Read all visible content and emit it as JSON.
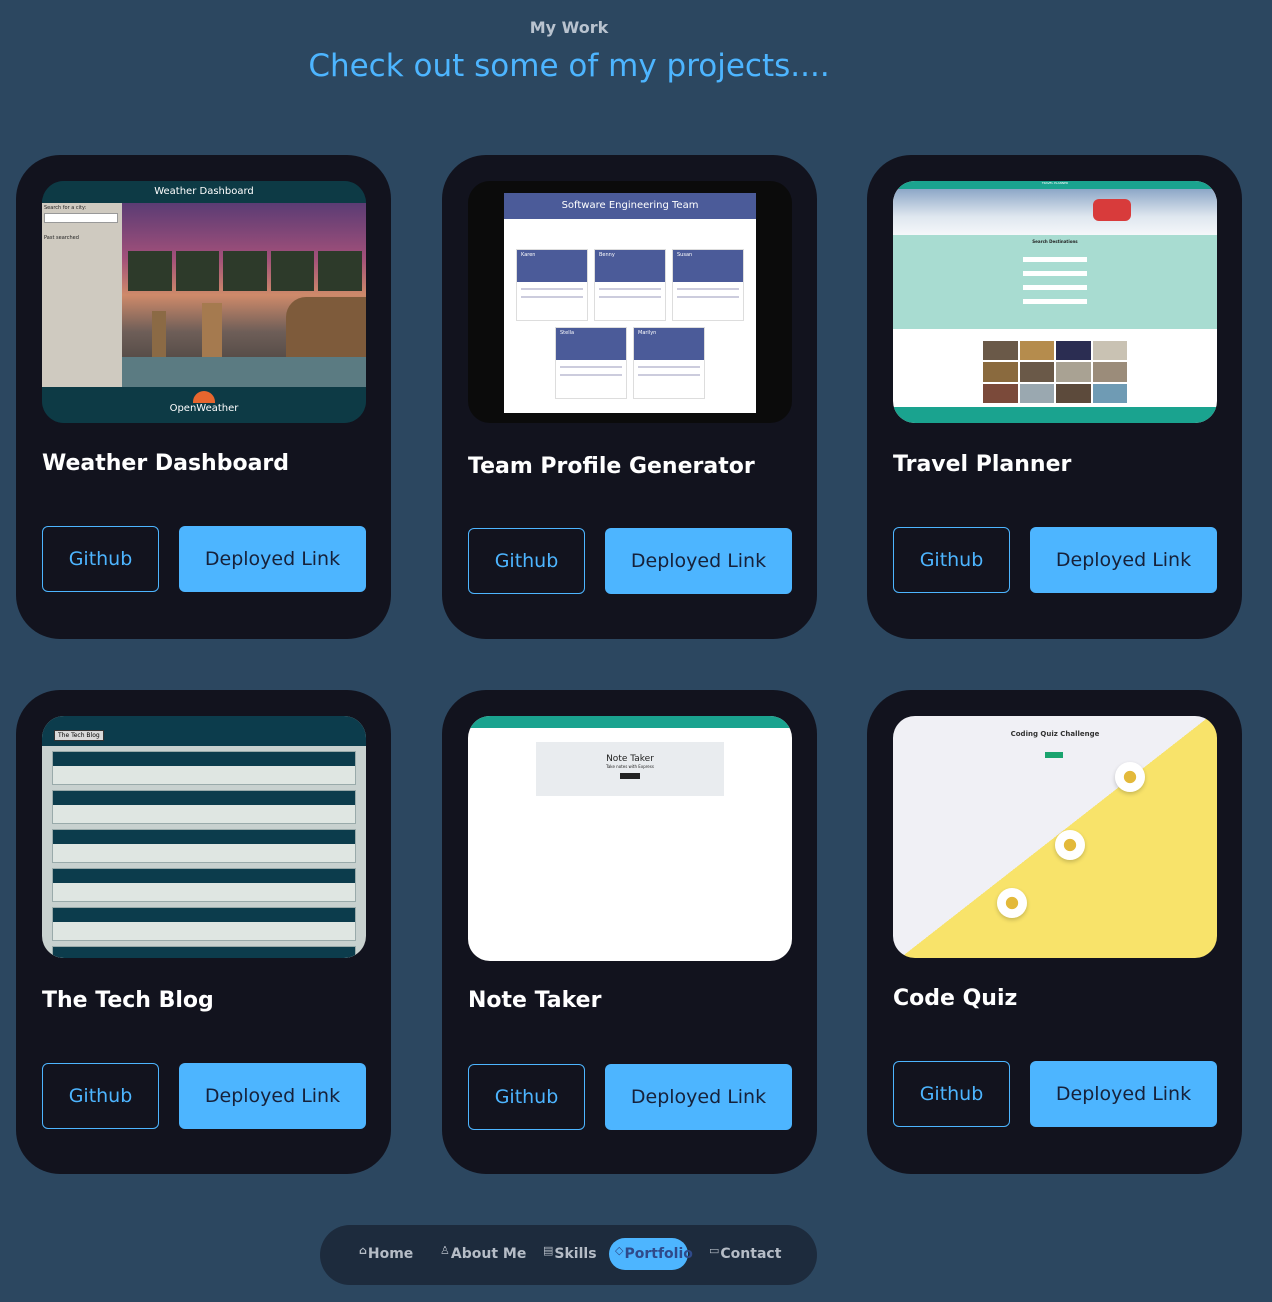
{
  "section": {
    "eyebrow": "My Work",
    "heading": "Check out some of my projects...."
  },
  "colors": {
    "background": "#2c4760",
    "card": "#12131e",
    "accent": "#4db5ff"
  },
  "projects": [
    {
      "title": "Weather Dashboard",
      "github_label": "Github",
      "deployed_label": "Deployed Link",
      "preview": {
        "header": "Weather Dashboard",
        "search_label": "Search for a city:",
        "history_label": "Past searched",
        "footer": "OpenWeather"
      }
    },
    {
      "title": "Team Profile Generator",
      "github_label": "Github",
      "deployed_label": "Deployed Link",
      "preview": {
        "header": "Software Engineering Team",
        "members": [
          "Karen",
          "Benny",
          "Susan",
          "Stella",
          "Marilyn"
        ]
      }
    },
    {
      "title": "Travel Planner",
      "github_label": "Github",
      "deployed_label": "Deployed Link",
      "preview": {
        "header": "TRAVEL PLANNER",
        "form_title": "Search Destinations"
      }
    },
    {
      "title": "The Tech Blog",
      "github_label": "Github",
      "deployed_label": "Deployed Link",
      "preview": {
        "header": "The Tech Blog"
      }
    },
    {
      "title": "Note Taker",
      "github_label": "Github",
      "deployed_label": "Deployed Link",
      "preview": {
        "header": "Note Taker",
        "subheader": "Take notes with Express"
      }
    },
    {
      "title": "Code Quiz",
      "github_label": "Github",
      "deployed_label": "Deployed Link",
      "preview": {
        "header": "Coding Quiz Challenge"
      }
    }
  ],
  "nav": {
    "items": [
      {
        "label": "Home",
        "icon": "home-icon"
      },
      {
        "label": "About Me",
        "icon": "user-icon"
      },
      {
        "label": "Skills",
        "icon": "book-icon"
      },
      {
        "label": "Portfolio",
        "icon": "diamond-icon"
      },
      {
        "label": "Contact",
        "icon": "message-icon"
      }
    ],
    "active": "Portfolio"
  }
}
